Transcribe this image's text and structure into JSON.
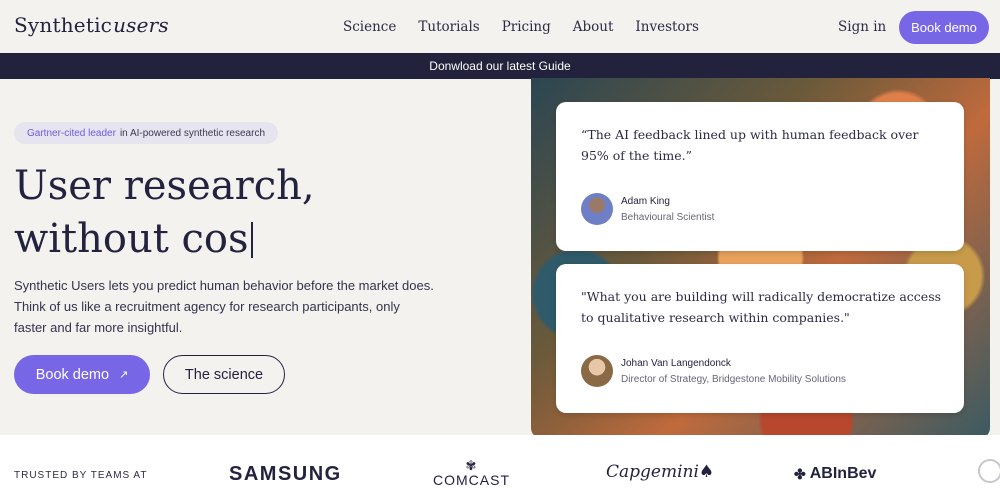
{
  "header": {
    "logo_main": "Synthetic",
    "logo_script": "users",
    "nav": [
      "Science",
      "Tutorials",
      "Pricing",
      "About",
      "Investors"
    ],
    "sign_in": "Sign in",
    "book_demo": "Book demo"
  },
  "banner": {
    "text": "Donwload our latest Guide"
  },
  "hero": {
    "badge_highlight": "Gartner-cited leader",
    "badge_text": "in AI-powered synthetic research",
    "title_line1": "User research,",
    "title_line2": "without cos",
    "description": "Synthetic Users lets you predict human behavior before the market does. Think of us like a recruitment agency for research participants, only faster and far more insightful.",
    "primary_button": "Book demo",
    "primary_button_icon": "arrow-up-right-icon",
    "secondary_button": "The science"
  },
  "testimonials": [
    {
      "quote": "“The AI feedback lined up with human feedback over 95% of the time.”",
      "name": "Adam King",
      "role": "Behavioural Scientist"
    },
    {
      "quote": "\"What you are building will radically democratize access to qualitative research within companies.\"",
      "name": "Johan Van Langendonck",
      "role": "Director of Strategy, Bridgestone Mobility Solutions"
    }
  ],
  "trusted": {
    "label": "TRUSTED BY TEAMS AT",
    "logos": [
      "SAMSUNG",
      "COMCAST",
      "Capgemini",
      "ABInBev"
    ]
  },
  "colors": {
    "accent": "#7766e6",
    "banner_bg": "#22223c",
    "page_bg": "#f3f2ee",
    "text": "#23233f"
  }
}
